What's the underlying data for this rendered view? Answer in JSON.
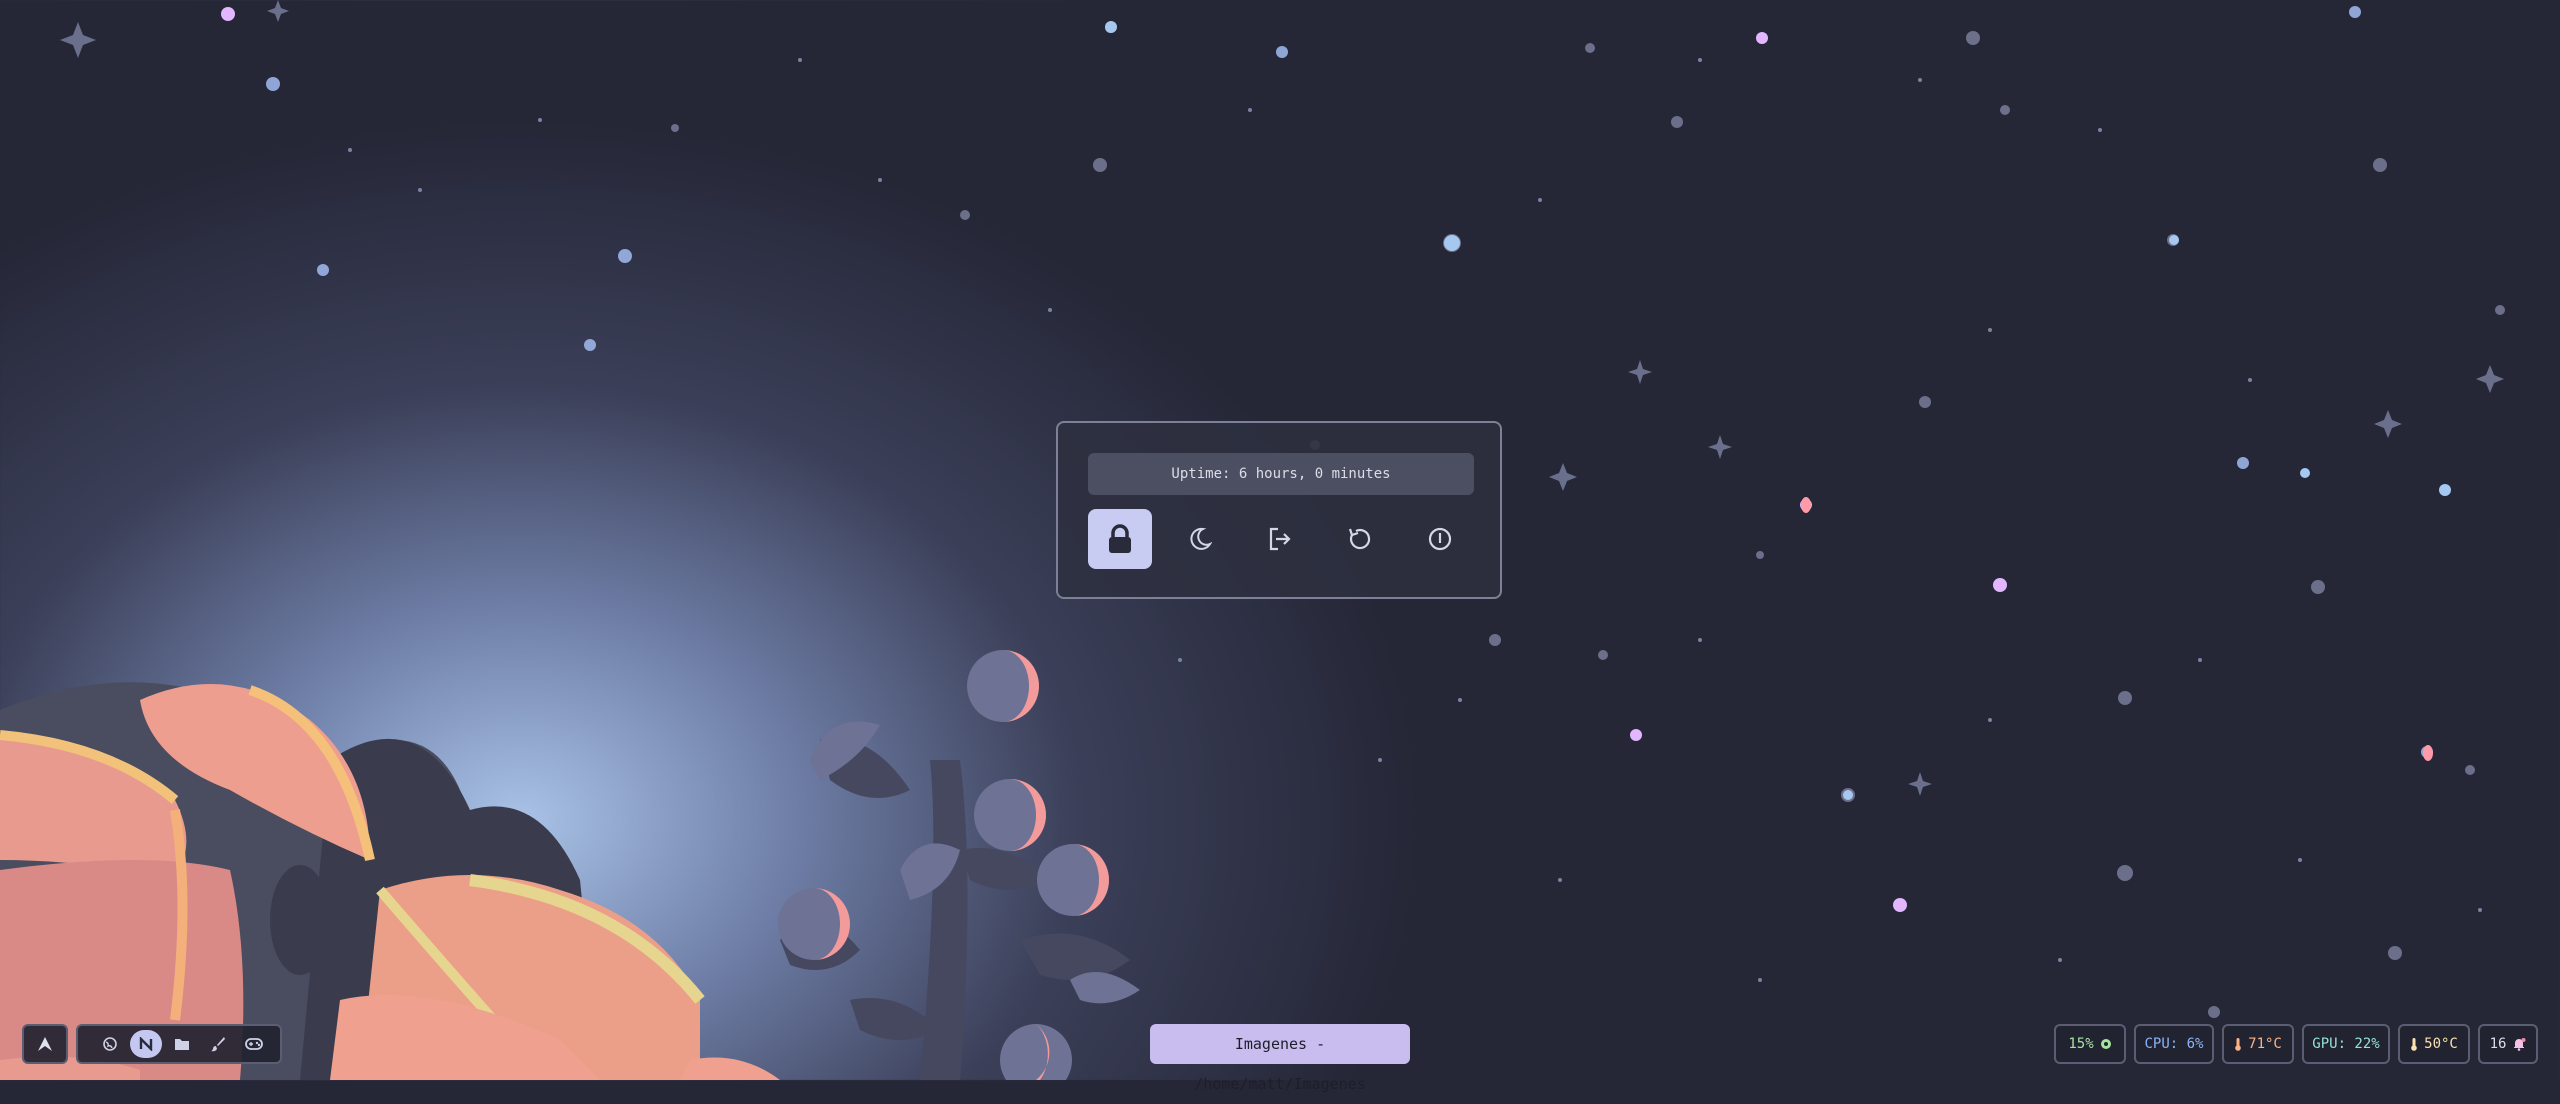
{
  "power_menu": {
    "uptime": "Uptime: 6 hours, 0 minutes",
    "buttons": [
      {
        "name": "lock",
        "icon": "lock-icon",
        "active": true
      },
      {
        "name": "suspend",
        "icon": "moon-icon",
        "active": false
      },
      {
        "name": "logout",
        "icon": "logout-icon",
        "active": false
      },
      {
        "name": "reboot",
        "icon": "reboot-icon",
        "active": false
      },
      {
        "name": "shutdown",
        "icon": "power-info-icon",
        "active": false
      }
    ]
  },
  "taskbar": {
    "launcher_icon": "arch-logo-icon",
    "workspaces": [
      {
        "icon": "globe-icon",
        "active": false
      },
      {
        "icon": "neovim-icon",
        "active": true
      },
      {
        "icon": "folder-icon",
        "active": false
      },
      {
        "icon": "brush-icon",
        "active": false
      },
      {
        "icon": "gamepad-icon",
        "active": false
      }
    ],
    "window_title": "Imagenes - /home/matt/Imagenes",
    "stats": {
      "memory": "15%",
      "cpu": "CPU: 6%",
      "cpu_temp": "71°C",
      "gpu": "GPU: 22%",
      "gpu_temp": "50°C",
      "notifications": "16"
    }
  },
  "colors": {
    "accent": "#c9bdf0",
    "active_button": "#c9ccf2",
    "memory_text": "#a6e3a1",
    "cpu_text": "#89b4fa",
    "cpu_temp_text": "#fab387",
    "gpu_text": "#94e2d5",
    "gpu_temp_text": "#f9e2af",
    "notif_text": "#f5c2e7"
  }
}
